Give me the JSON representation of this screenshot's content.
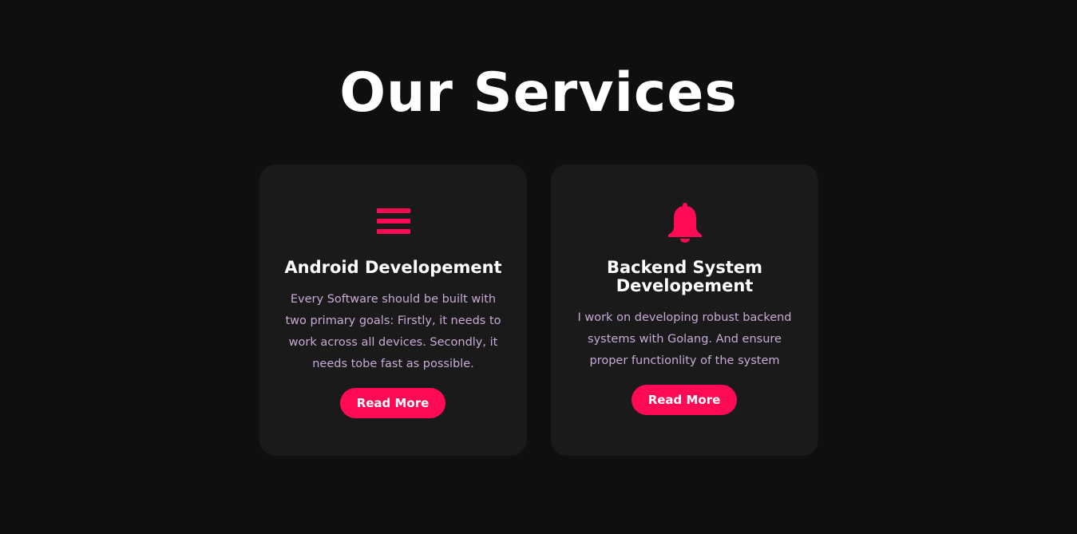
{
  "section_title": "Our Services",
  "colors": {
    "background": "#0f0f0f",
    "card": "#1a1a1b",
    "accent": "#ff0a54",
    "title_text": "#ffffff",
    "description_text": "#c9a9d6"
  },
  "cards": [
    {
      "icon": "bars-icon",
      "title": "Android Developement",
      "description": "Every Software should be built with two primary goals: Firstly, it needs to work across all devices. Secondly, it needs tobe fast as possible.",
      "button_label": "Read More"
    },
    {
      "icon": "bell-icon",
      "title": "Backend System Developement",
      "description": "I work on developing robust backend systems with Golang. And ensure proper functionlity of the system",
      "button_label": "Read More"
    }
  ]
}
